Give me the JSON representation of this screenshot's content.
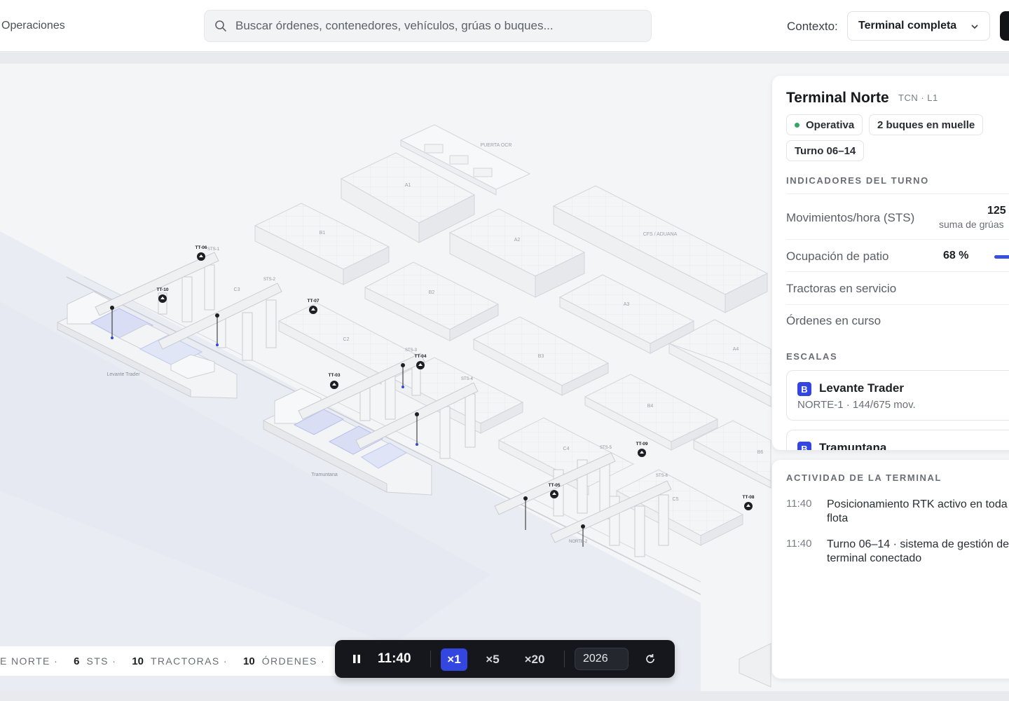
{
  "topbar": {
    "breadcrumb": "Operaciones",
    "search_placeholder": "Buscar órdenes, contenedores, vehículos, grúas o buques...",
    "context_label": "Contexto:",
    "context_value": "Terminal completa"
  },
  "map": {
    "blocks": [
      "PUERTA OCR",
      "A1",
      "B1",
      "A2",
      "CFS / ADUANA",
      "B2",
      "A3",
      "C2",
      "B3",
      "A4",
      "C3",
      "B4",
      "C4",
      "B6",
      "C5"
    ],
    "vessel_labels": [
      "Levante Trader",
      "Tramuntana"
    ],
    "crane_labels": [
      "STS-1",
      "STS-2",
      "STS-3",
      "STS-4",
      "STS-5",
      "STS-6"
    ],
    "berth_label": "NORTE-2",
    "tractors": [
      "TT-06",
      "TT-10",
      "TT-07",
      "TT-03",
      "TT-04",
      "TT-09",
      "TT-05",
      "TT-08"
    ]
  },
  "terminal": {
    "name": "Terminal Norte",
    "code": "TCN · L1",
    "status": "Operativa",
    "vessels_at_berth": "2 buques en muelle",
    "shift": "Turno 06–14",
    "kpi_section": "INDICADORES DEL TURNO",
    "kpis": [
      {
        "label": "Movimientos/hora (STS)",
        "value": "125",
        "sub": "suma de grúas"
      },
      {
        "label": "Ocupación de patio",
        "value": "68 %",
        "fraction": 0.68
      },
      {
        "label": "Tractoras en servicio",
        "value": ""
      },
      {
        "label": "Órdenes en curso",
        "value": ""
      }
    ],
    "calls_section": "ESCALAS",
    "calls": [
      {
        "badge": "B",
        "name": "Levante Trader",
        "detail": "NORTE-1 · 144/675 mov."
      },
      {
        "badge": "B",
        "name": "Tramuntana",
        "detail": ""
      }
    ]
  },
  "activity": {
    "title": "ACTIVIDAD DE LA TERMINAL",
    "items": [
      {
        "time": "11:40",
        "text": "Posicionamiento RTK activo en toda la flota"
      },
      {
        "time": "11:40",
        "text": "Turno 06–14 · sistema de gestión de terminal conectado"
      }
    ]
  },
  "stats": {
    "lead": "E NORTE ·",
    "sts_count": "6",
    "sts_label": "STS ·",
    "tractors_count": "10",
    "tractors_label": "TRACTORAS ·",
    "orders_count": "10",
    "orders_label": "ÓRDENES ·"
  },
  "playback": {
    "time": "11:40",
    "speeds": [
      "×1",
      "×5",
      "×20"
    ],
    "active_speed": "×1",
    "year": "2026"
  },
  "colors": {
    "accent": "#3346e0",
    "status_ok": "#2fa866",
    "dark": "#15171c"
  }
}
